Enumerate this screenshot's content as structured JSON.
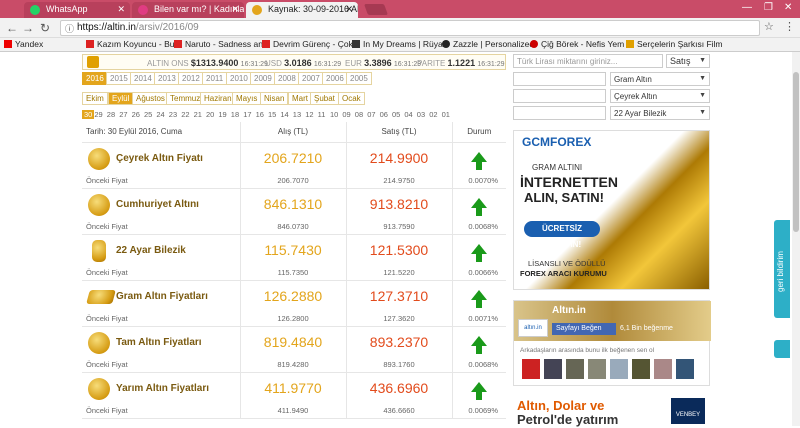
{
  "browser": {
    "tabs": [
      {
        "label": "WhatsApp",
        "active": false,
        "color": "#25d366"
      },
      {
        "label": "Bilen var mı? | Kadınlar K",
        "active": false,
        "color": "#e03c82"
      },
      {
        "label": "Kaynak: 30-09-2016 Altın",
        "active": true,
        "color": "#e3a51c"
      }
    ],
    "url_domain": "https://altin.in",
    "url_path": "/arsiv/2016/09",
    "bookmarks": [
      "Yandex",
      "Kazım Koyuncu - Bu I",
      "Naruto - Sadness and",
      "Devrim Gürenç - Çok",
      "In My Dreams | Rüyal",
      "Zazzle | Personalized",
      "Çiğ Börek - Nefis Yem",
      "Serçelerin Şarkısı Film"
    ]
  },
  "ticker": [
    {
      "label": "ALTIN ONS",
      "value": "$1313.9400",
      "time": "16:31:29"
    },
    {
      "label": "USD",
      "value": "3.0186",
      "time": "16:31:29"
    },
    {
      "label": "EUR",
      "value": "3.3896",
      "time": "16:31:29"
    },
    {
      "label": "PARITE",
      "value": "1.1221",
      "time": "16:31:29"
    }
  ],
  "years": [
    "2016",
    "2015",
    "2014",
    "2013",
    "2012",
    "2011",
    "2010",
    "2009",
    "2008",
    "2007",
    "2006",
    "2005"
  ],
  "months": [
    "Ekim",
    "Eylül",
    "Ağustos",
    "Temmuz",
    "Haziran",
    "Mayıs",
    "Nisan",
    "Mart",
    "Şubat",
    "Ocak"
  ],
  "days": [
    "30",
    "29",
    "28",
    "27",
    "26",
    "25",
    "24",
    "23",
    "22",
    "21",
    "20",
    "19",
    "18",
    "17",
    "16",
    "15",
    "14",
    "13",
    "12",
    "11",
    "10",
    "09",
    "08",
    "07",
    "06",
    "05",
    "04",
    "03",
    "02",
    "01"
  ],
  "table": {
    "date_label": "Tarih: 30 Eylül 2016, Cuma",
    "col_buy": "Alış (TL)",
    "col_sell": "Satış (TL)",
    "col_status": "Durum",
    "prev_label": "Önceki Fiyat",
    "rows": [
      {
        "name": "Çeyrek Altın Fiyatı",
        "buy": "206.7210",
        "sell": "214.9900",
        "prev_buy": "206.7070",
        "prev_sell": "214.9750",
        "change": "0.0070%"
      },
      {
        "name": "Cumhuriyet Altını",
        "buy": "846.1310",
        "sell": "913.8210",
        "prev_buy": "846.0730",
        "prev_sell": "913.7590",
        "change": "0.0068%"
      },
      {
        "name": "22 Ayar Bilezik",
        "buy": "115.7430",
        "sell": "121.5300",
        "prev_buy": "115.7350",
        "prev_sell": "121.5220",
        "change": "0.0066%"
      },
      {
        "name": "Gram Altın Fiyatları",
        "buy": "126.2880",
        "sell": "127.3710",
        "prev_buy": "126.2800",
        "prev_sell": "127.3620",
        "change": "0.0071%"
      },
      {
        "name": "Tam Altın Fiyatları",
        "buy": "819.4840",
        "sell": "893.2370",
        "prev_buy": "819.4280",
        "prev_sell": "893.1760",
        "change": "0.0068%"
      },
      {
        "name": "Yarım Altın Fiyatları",
        "buy": "411.9770",
        "sell": "436.6960",
        "prev_buy": "411.9490",
        "prev_sell": "436.6660",
        "change": "0.0069%"
      }
    ]
  },
  "converter": {
    "amount_placeholder": "Türk Lirası miktarını giriniz...",
    "mode": "Satış",
    "options": [
      "Gram Altın",
      "Çeyrek Altın",
      "22 Ayar Bilezik"
    ]
  },
  "ad1": {
    "brand": "GCMFOREX",
    "line1": "GRAM ALTINI",
    "line2": "İNTERNETTEN",
    "line3": "ALIN, SATIN!",
    "cta": "ÜCRETSİZ DENEYİN!",
    "line4": "LİSANSLI VE ÖDÜLLÜ",
    "line5": "FOREX ARACI KURUMU"
  },
  "facebook": {
    "title": "Altın.in",
    "like_label": "Sayfayı Beğen",
    "count": "6,1 Bin beğenme",
    "friends": "Arkadaşların arasında bunu ilk beğenen sen ol"
  },
  "ad2": {
    "line1": "Altın, Dolar ve",
    "line2": "Petrol'de yatırım",
    "logo": "VENBEY"
  },
  "feedback_label": "geri bildirim"
}
